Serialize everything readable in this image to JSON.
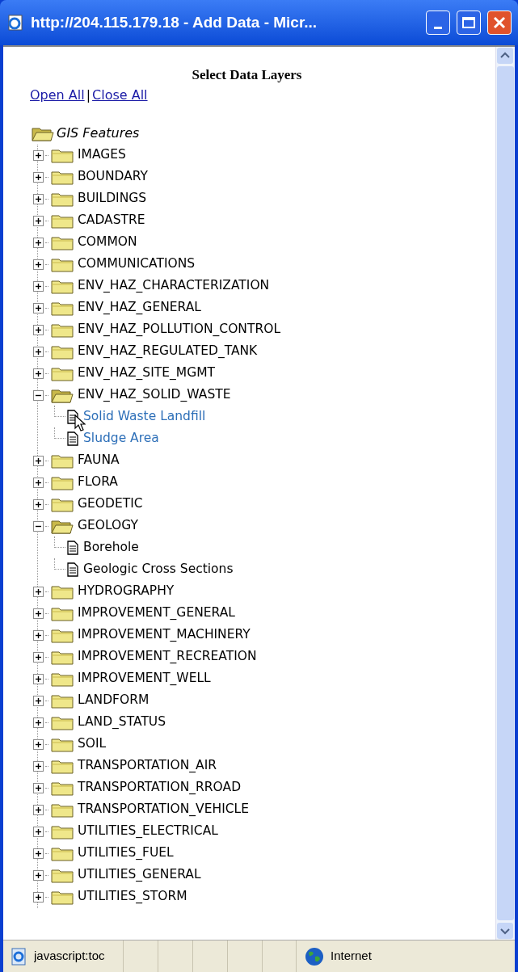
{
  "window": {
    "title": "http://204.115.179.18 - Add Data - Micr..."
  },
  "heading": "Select Data Layers",
  "links": [
    "Open All",
    "Close All"
  ],
  "separator": "|",
  "tree": {
    "label": "GIS Features",
    "expanded": true,
    "children": [
      {
        "label": "IMAGES",
        "expanded": false
      },
      {
        "label": "BOUNDARY",
        "expanded": false
      },
      {
        "label": "BUILDINGS",
        "expanded": false
      },
      {
        "label": "CADASTRE",
        "expanded": false
      },
      {
        "label": "COMMON",
        "expanded": false
      },
      {
        "label": "COMMUNICATIONS",
        "expanded": false
      },
      {
        "label": "ENV_HAZ_CHARACTERIZATION",
        "expanded": false
      },
      {
        "label": "ENV_HAZ_GENERAL",
        "expanded": false
      },
      {
        "label": "ENV_HAZ_POLLUTION_CONTROL",
        "expanded": false
      },
      {
        "label": "ENV_HAZ_REGULATED_TANK",
        "expanded": false
      },
      {
        "label": "ENV_HAZ_SITE_MGMT",
        "expanded": false
      },
      {
        "label": "ENV_HAZ_SOLID_WASTE",
        "expanded": true,
        "children": [
          {
            "label": "Solid Waste Landfill",
            "highlighted": true
          },
          {
            "label": "Sludge Area",
            "highlighted": true
          }
        ]
      },
      {
        "label": "FAUNA",
        "expanded": false
      },
      {
        "label": "FLORA",
        "expanded": false
      },
      {
        "label": "GEODETIC",
        "expanded": false
      },
      {
        "label": "GEOLOGY",
        "expanded": true,
        "children": [
          {
            "label": "Borehole",
            "highlighted": false
          },
          {
            "label": "Geologic Cross Sections",
            "highlighted": false
          }
        ]
      },
      {
        "label": "HYDROGRAPHY",
        "expanded": false
      },
      {
        "label": "IMPROVEMENT_GENERAL",
        "expanded": false
      },
      {
        "label": "IMPROVEMENT_MACHINERY",
        "expanded": false
      },
      {
        "label": "IMPROVEMENT_RECREATION",
        "expanded": false
      },
      {
        "label": "IMPROVEMENT_WELL",
        "expanded": false
      },
      {
        "label": "LANDFORM",
        "expanded": false
      },
      {
        "label": "LAND_STATUS",
        "expanded": false
      },
      {
        "label": "SOIL",
        "expanded": false
      },
      {
        "label": "TRANSPORTATION_AIR",
        "expanded": false
      },
      {
        "label": "TRANSPORTATION_RROAD",
        "expanded": false
      },
      {
        "label": "TRANSPORTATION_VEHICLE",
        "expanded": false
      },
      {
        "label": "UTILITIES_ELECTRICAL",
        "expanded": false
      },
      {
        "label": "UTILITIES_FUEL",
        "expanded": false
      },
      {
        "label": "UTILITIES_GENERAL",
        "expanded": false
      },
      {
        "label": "UTILITIES_STORM",
        "expanded": false
      }
    ]
  },
  "status_bar": {
    "text": "javascript:toc",
    "zone": "Internet"
  }
}
